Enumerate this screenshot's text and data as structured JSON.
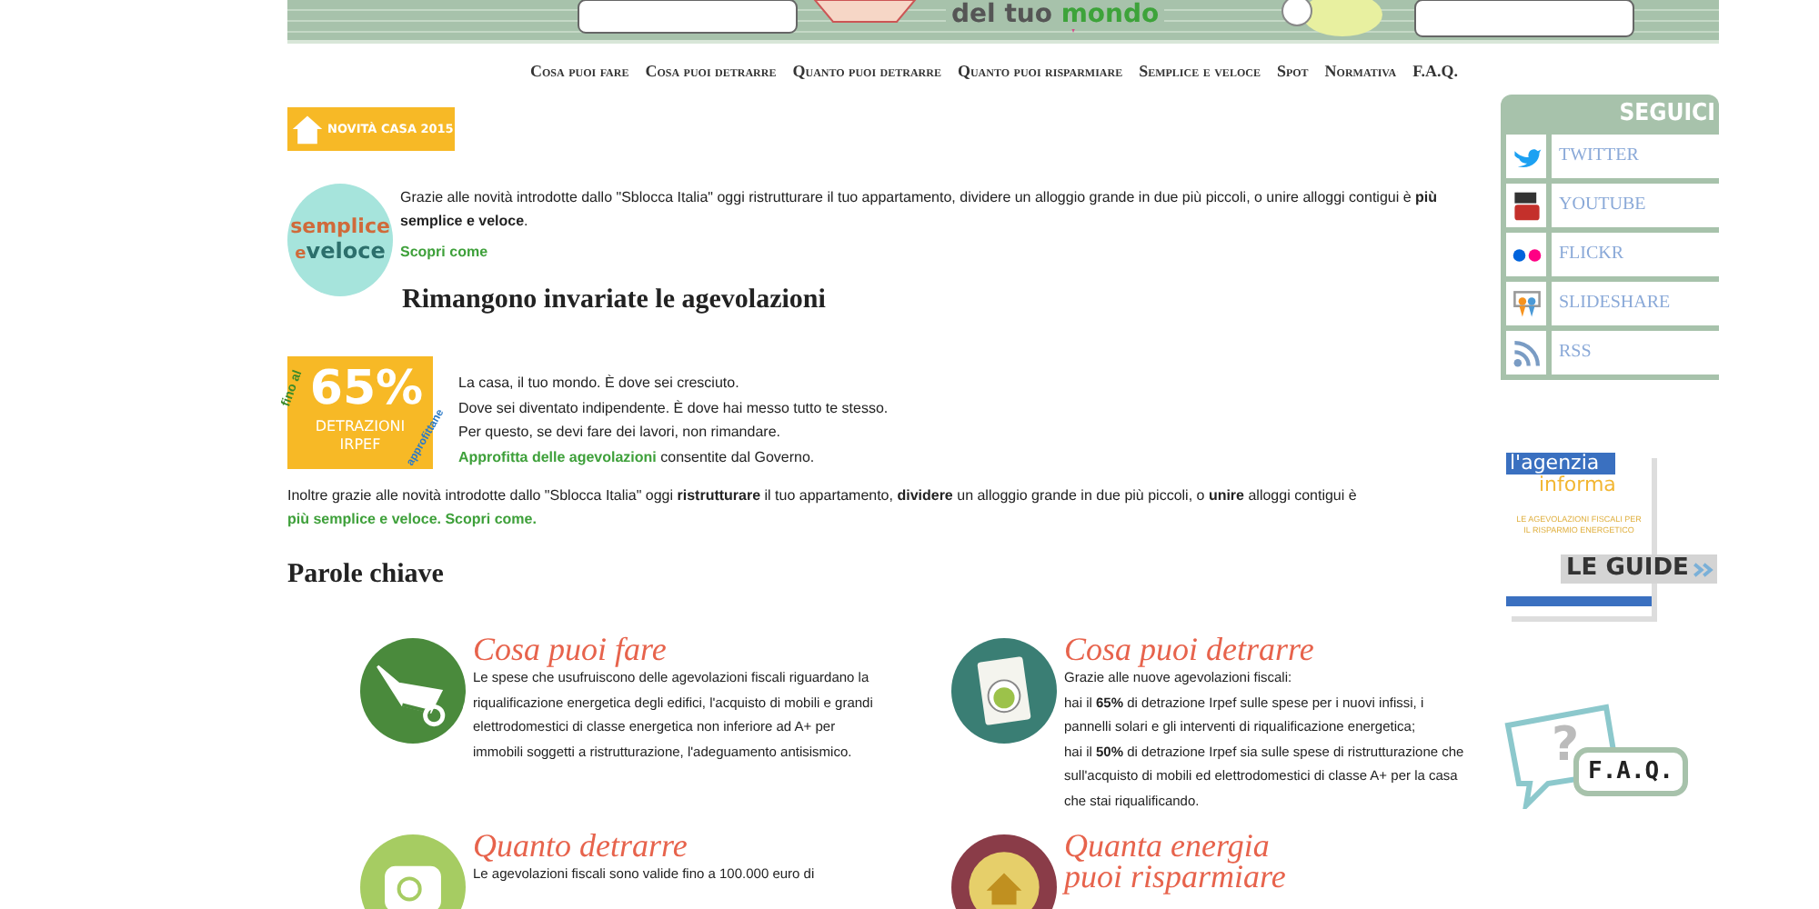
{
  "banner": {
    "title_start": "del tuo",
    "title_end": "mondo"
  },
  "nav": [
    {
      "label": "Cosa puoi fare"
    },
    {
      "label": "Cosa puoi detrarre"
    },
    {
      "label": "Quanto puoi detrarre"
    },
    {
      "label": "Quanto puoi risparmiare"
    },
    {
      "label": "Semplice e veloce"
    },
    {
      "label": "Spot"
    },
    {
      "label": "Normativa"
    },
    {
      "label": "F.A.Q."
    }
  ],
  "news_badge": "NOVITÀ CASA 2015",
  "intro": {
    "logo": {
      "top": "semplice",
      "e": "e",
      "bottom": "veloce"
    },
    "text": "Grazie alle novità introdotte dallo \"Sblocca Italia\" oggi ristrutturare il tuo appartamento, dividere un alloggio grande in due più piccoli, o unire alloggi contigui è **più semplice e veloce**.",
    "link": "Scopri come"
  },
  "heading": "Rimangono invariate le agevolazioni",
  "promo": {
    "badge": {
      "top": "fino al",
      "value": "65%",
      "line1": "DETRAZIONI",
      "line2": "IRPEF",
      "side": "approfittane"
    },
    "lines": [
      [
        {
          "kind": "plain",
          "text": "La casa, il tuo mondo. È dove sei cresciuto."
        }
      ],
      [
        {
          "kind": "plain",
          "text": "Dove sei diventato indipendente. È dove hai messo tutto te stesso."
        }
      ],
      [
        {
          "kind": "plain",
          "text": "Per questo, se devi fare dei lavori, non rimandare."
        }
      ],
      [
        {
          "kind": "link",
          "text": "Approfitta delle agevolazioni"
        },
        {
          "kind": "plain",
          "text": " consentite dal Governo."
        }
      ]
    ]
  },
  "summary": [
    {
      "kind": "plain",
      "text": "Inoltre grazie alle novità introdotte dallo \"Sblocca Italia\" oggi "
    },
    {
      "kind": "bold",
      "text": "ristrutturare"
    },
    {
      "kind": "plain",
      "text": " il tuo appartamento, "
    },
    {
      "kind": "bold",
      "text": "dividere"
    },
    {
      "kind": "plain",
      "text": " un alloggio grande in due più piccoli, o "
    },
    {
      "kind": "bold",
      "text": "unire"
    },
    {
      "kind": "plain",
      "text": " alloggi contigui è "
    },
    {
      "kind": "link",
      "text": "più semplice e veloce."
    },
    {
      "kind": "link",
      "text": "Scopri come."
    }
  ],
  "keywords_heading": "Parole chiave",
  "cards": [
    {
      "title": "Cosa puoi fare",
      "kind": "wheelbarrow",
      "paragraphs": [
        "Le spese che usufruiscono delle agevolazioni fiscali riguardano la riqualificazione energetica degli edifici, l'acquisto di mobili e grandi elettrodomestici di classe energetica non inferiore ad A+ per immobili soggetti a ristrutturazione, l'adeguamento antisismico."
      ]
    },
    {
      "title": "Cosa puoi detrarre",
      "kind": "washer",
      "paragraphs": [
        "Grazie alle nuove agevolazioni fiscali:",
        "hai il **65%** di detrazione Irpef sulle spese per i nuovi infissi, i pannelli solari e gli interventi di riqualificazione energetica;",
        "hai il **50%** di detrazione Irpef sia sulle spese di ristrutturazione che sull'acquisto di mobili ed elettrodomestici di classe A+ per la casa che stai riqualificando."
      ]
    },
    {
      "title": "Quanto detrarre",
      "kind": "wallet",
      "paragraphs": [
        "Le agevolazioni fiscali sono valide fino a 100.000 euro di"
      ]
    },
    {
      "title": "Quanta energia puoi risparmiare",
      "kind": "house"
    }
  ],
  "follow": {
    "title": "SEGUICI",
    "items": [
      {
        "label": "TWITTER",
        "kind": "twitter"
      },
      {
        "label": "YOUTUBE",
        "kind": "youtube"
      },
      {
        "label": "FLICKR",
        "kind": "flickr"
      },
      {
        "label": "SLIDESHARE",
        "kind": "slideshare"
      },
      {
        "label": "RSS",
        "kind": "rss"
      }
    ]
  },
  "guide": {
    "brand_start": "l'agenzia",
    "brand_end": "informa",
    "subtitle": "LE AGEVOLAZIONI FISCALI PER IL RISPARMIO ENERGETICO",
    "label": "LE GUIDE"
  },
  "faq": {
    "mark": "?",
    "label": "F.A.Q."
  }
}
